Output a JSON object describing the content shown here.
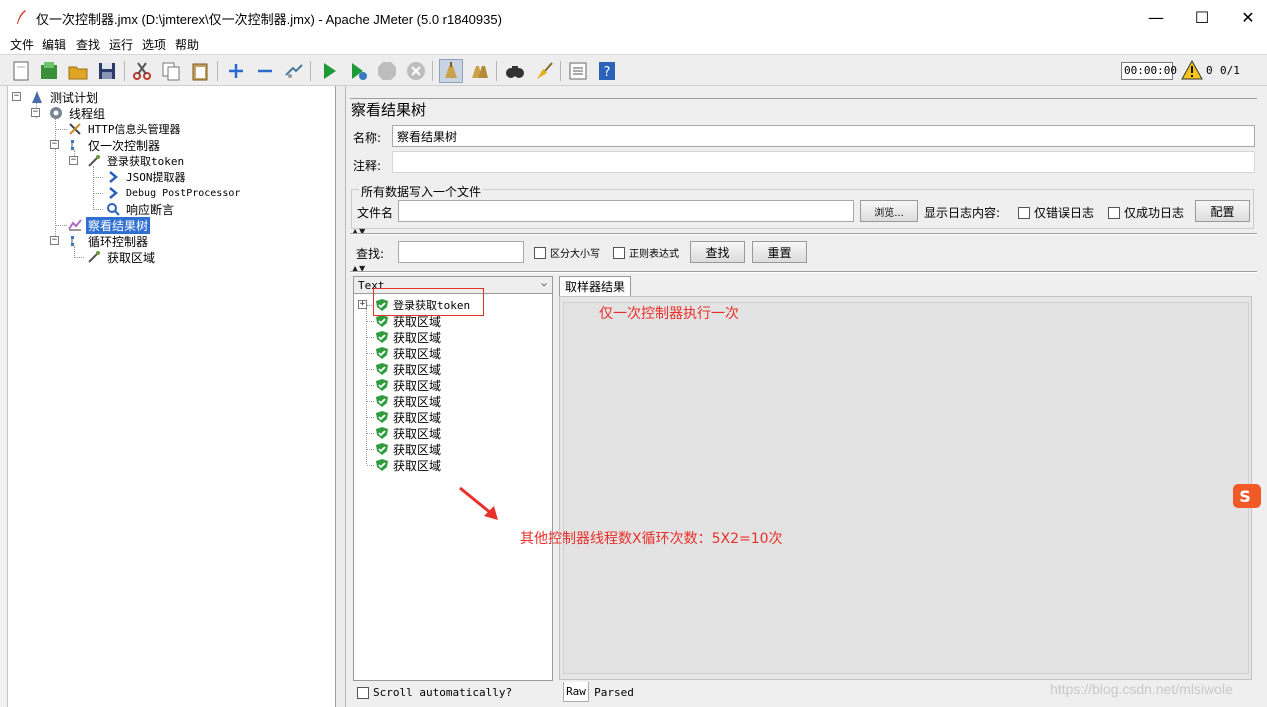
{
  "window": {
    "title": "仅一次控制器.jmx (D:\\jmterex\\仅一次控制器.jmx) - Apache JMeter (5.0 r1840935)",
    "minimize": "—",
    "maximize": "☐",
    "close": "✕"
  },
  "menu": [
    "文件",
    "编辑",
    "查找",
    "运行",
    "选项",
    "帮助"
  ],
  "toolbar": {
    "icons": [
      "new-icon",
      "templates-icon",
      "open-icon",
      "save-icon",
      "cut-icon",
      "copy-icon",
      "paste-icon",
      "expand-icon",
      "collapse-icon",
      "toggle-icon",
      "start-icon",
      "start-no-pause-icon",
      "stop-icon",
      "shutdown-icon",
      "clear-icon",
      "clear-all-icon",
      "search-icon",
      "reset-search-icon",
      "function-helper-icon",
      "help-icon"
    ],
    "timer": "00:00:00",
    "warnings": "0",
    "threads": "0/1"
  },
  "tree": [
    {
      "label": "测试计划",
      "icon": "test-plan-icon"
    },
    {
      "label": "线程组",
      "icon": "thread-group-icon"
    },
    {
      "label": "HTTP信息头管理器",
      "icon": "header-manager-icon"
    },
    {
      "label": "仅一次控制器",
      "icon": "controller-icon"
    },
    {
      "label": "登录获取token",
      "icon": "http-sampler-icon"
    },
    {
      "label": "JSON提取器",
      "icon": "extractor-icon"
    },
    {
      "label": "Debug PostProcessor",
      "icon": "postprocessor-icon"
    },
    {
      "label": "响应断言",
      "icon": "assertion-icon"
    },
    {
      "label": "察看结果树",
      "icon": "listener-icon",
      "selected": true
    },
    {
      "label": "循环控制器",
      "icon": "loop-controller-icon"
    },
    {
      "label": "获取区域",
      "icon": "http-sampler-icon"
    }
  ],
  "panel": {
    "title": "察看结果树",
    "name_label": "名称:",
    "name_value": "察看结果树",
    "comment_label": "注释:",
    "comment_value": "",
    "file_section": "所有数据写入一个文件",
    "filename_label": "文件名",
    "filename_value": "",
    "browse": "浏览...",
    "log_content_label": "显示日志内容:",
    "errors_only": "仅错误日志",
    "success_only": "仅成功日志",
    "configure": "配置",
    "search_label": "查找:",
    "search_value": "",
    "case_sensitive": "区分大小写",
    "regex": "正则表达式",
    "find_button": "查找",
    "reset_button": "重置"
  },
  "results": {
    "render_mode": "Text",
    "items": [
      "登录获取token",
      "获取区域",
      "获取区域",
      "获取区域",
      "获取区域",
      "获取区域",
      "获取区域",
      "获取区域",
      "获取区域",
      "获取区域",
      "获取区域"
    ],
    "scroll_auto": "Scroll automatically?",
    "tab_sampler": "取样器结果",
    "tab_raw": "Raw",
    "tab_parsed": "Parsed"
  },
  "annotations": {
    "once_note": "仅一次控制器执行一次",
    "loop_note": "其他控制器线程数X循环次数：5X2=10次"
  },
  "watermark": "https://blog.csdn.net/mlsiwole",
  "colors": {
    "selection": "#2f6fd1",
    "annotation": "#e8302a",
    "success": "#2e9e3c"
  }
}
